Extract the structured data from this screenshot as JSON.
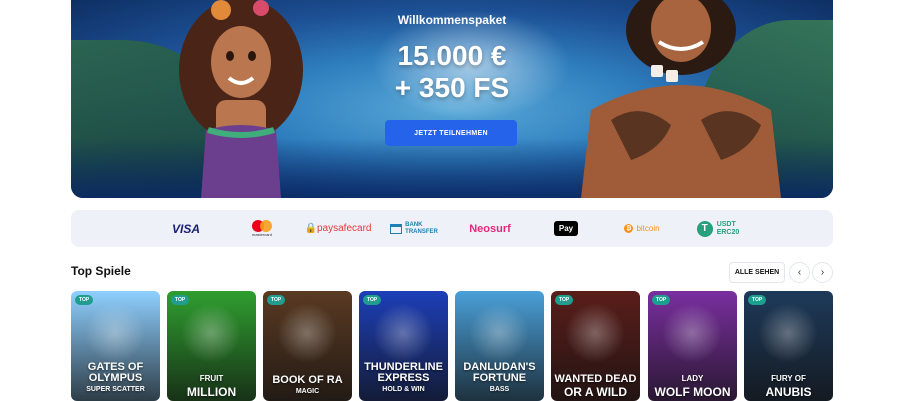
{
  "hero": {
    "subtitle": "Willkommenspaket",
    "amount_line1": "15.000 €",
    "amount_line2": "+ 350 FS",
    "cta_label": "JETZT TEILNEHMEN"
  },
  "payments": [
    {
      "name": "VISA"
    },
    {
      "name": "mastercard"
    },
    {
      "name": "paysafecard"
    },
    {
      "name_line1": "BANK",
      "name_line2": "TRANSFER"
    },
    {
      "name": "Neosurf"
    },
    {
      "name": "Pay"
    },
    {
      "name": "bitcoin"
    },
    {
      "name_line1": "USDT",
      "name_line2": "ERC20"
    }
  ],
  "section": {
    "title": "Top Spiele",
    "see_all_label": "ALLE SEHEN",
    "prev_icon": "‹",
    "next_icon": "›"
  },
  "games": [
    {
      "badge": "TOP",
      "title": "GATES OF\nOLYMPUS",
      "subtitle": "SUPER SCATTER",
      "color": "#8fd0ff"
    },
    {
      "badge": "TOP",
      "title": "FRUIT",
      "subtitle": "MILLION",
      "color": "#2f9e2f"
    },
    {
      "badge": "TOP",
      "title": "BOOK OF RA",
      "subtitle": "MAGIC",
      "color": "#5a3a22"
    },
    {
      "badge": "TOP",
      "title": "THUNDERLINE\nEXPRESS",
      "subtitle": "HOLD & WIN",
      "color": "#1d3fb8"
    },
    {
      "badge": "",
      "title": "DANLUDAN'S\nFORTUNE",
      "subtitle": "BASS",
      "color": "#4aa0d8"
    },
    {
      "badge": "TOP",
      "title": "WANTED DEAD",
      "subtitle": "OR A WILD",
      "color": "#5a1e1a"
    },
    {
      "badge": "TOP",
      "title": "LADY",
      "subtitle": "WOLF MOON",
      "color": "#7a2fa0"
    },
    {
      "badge": "TOP",
      "title": "FURY OF",
      "subtitle": "ANUBIS",
      "color": "#1e3a5a"
    }
  ]
}
